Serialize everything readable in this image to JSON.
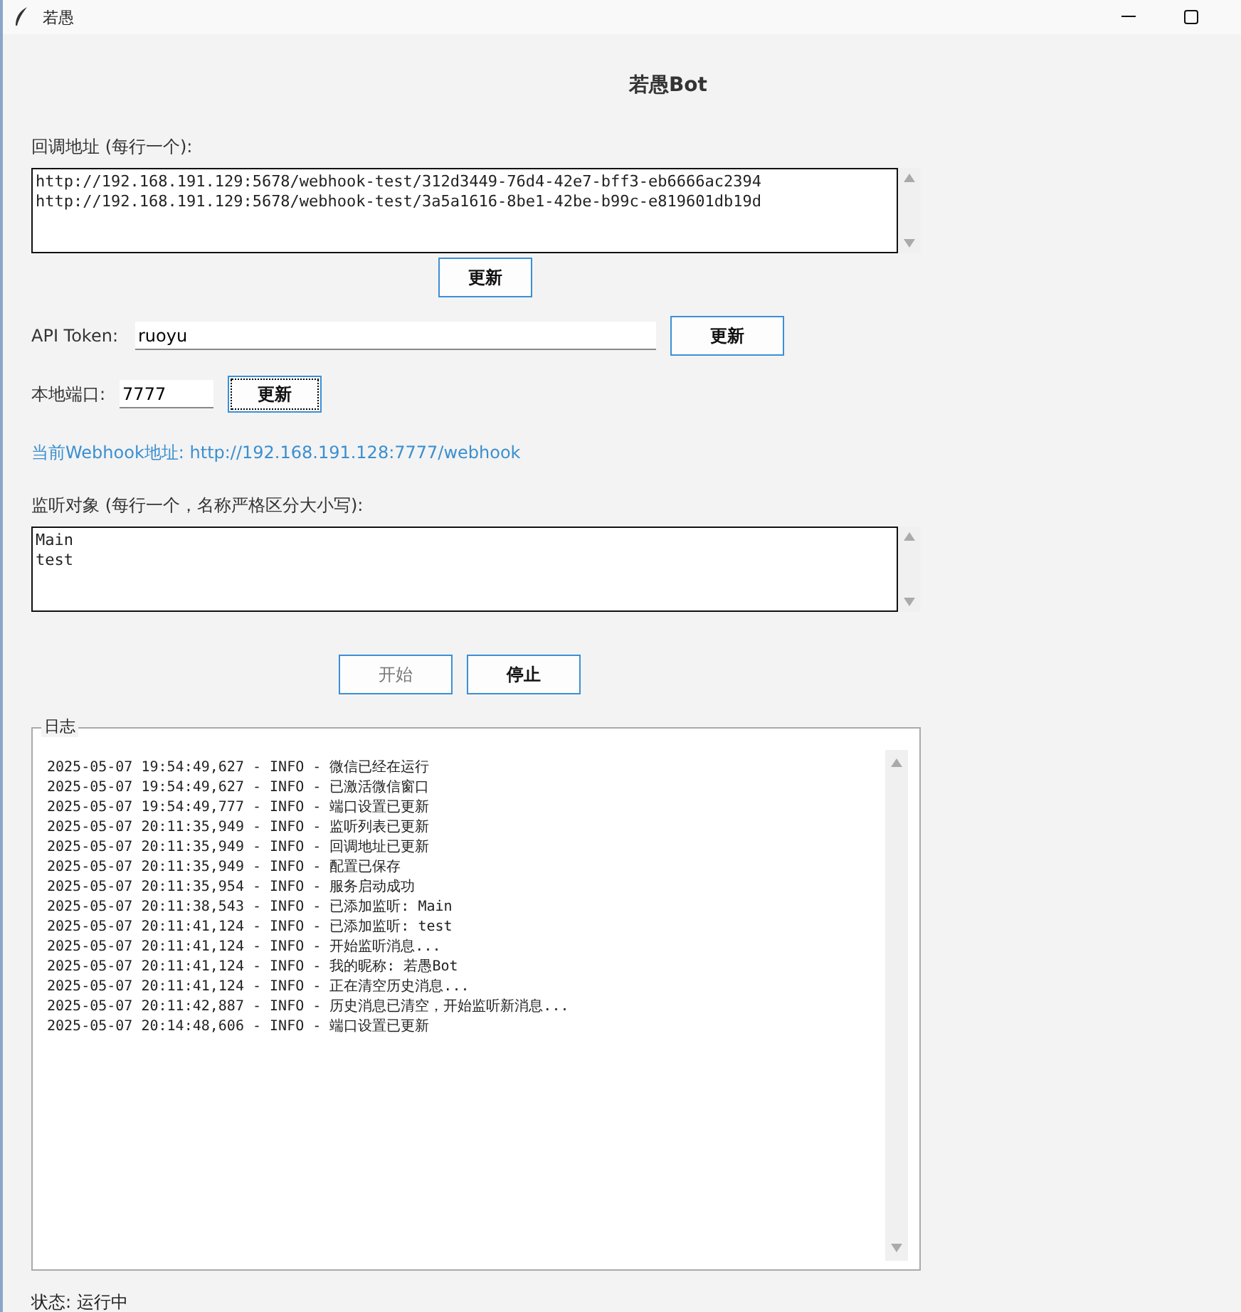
{
  "window": {
    "title": "若愚"
  },
  "heading": "若愚Bot",
  "callback": {
    "label": "回调地址 (每行一个):",
    "lines": [
      "http://192.168.191.129:5678/webhook-test/312d3449-76d4-42e7-bff3-eb6666ac2394",
      "http://192.168.191.129:5678/webhook-test/3a5a1616-8be1-42be-b99c-e819601db19d"
    ],
    "button": "更新"
  },
  "token": {
    "label": "API Token:",
    "value": "ruoyu",
    "button": "更新"
  },
  "port": {
    "label": "本地端口:",
    "value": "7777",
    "button": "更新",
    "focused": true
  },
  "webhook_url": "当前Webhook地址: http://192.168.191.128:7777/webhook",
  "listen": {
    "label": "监听对象 (每行一个，名称严格区分大小写):",
    "lines": [
      "Main",
      "test"
    ]
  },
  "actions": [
    {
      "label": "开始",
      "disabled": true
    },
    {
      "label": "停止",
      "disabled": false
    }
  ],
  "log": {
    "title": "日志",
    "lines": [
      "2025-05-07 19:54:49,627 - INFO - 微信已经在运行",
      "2025-05-07 19:54:49,627 - INFO - 已激活微信窗口",
      "2025-05-07 19:54:49,777 - INFO - 端口设置已更新",
      "2025-05-07 20:11:35,949 - INFO - 监听列表已更新",
      "2025-05-07 20:11:35,949 - INFO - 回调地址已更新",
      "2025-05-07 20:11:35,949 - INFO - 配置已保存",
      "2025-05-07 20:11:35,954 - INFO - 服务启动成功",
      "2025-05-07 20:11:38,543 - INFO - 已添加监听: Main",
      "2025-05-07 20:11:41,124 - INFO - 已添加监听: test",
      "2025-05-07 20:11:41,124 - INFO - 开始监听消息...",
      "2025-05-07 20:11:41,124 - INFO - 我的昵称: 若愚Bot",
      "2025-05-07 20:11:41,124 - INFO - 正在清空历史消息...",
      "2025-05-07 20:11:42,887 - INFO - 历史消息已清空，开始监听新消息...",
      "2025-05-07 20:14:48,606 - INFO - 端口设置已更新"
    ]
  },
  "status": "状态: 运行中"
}
